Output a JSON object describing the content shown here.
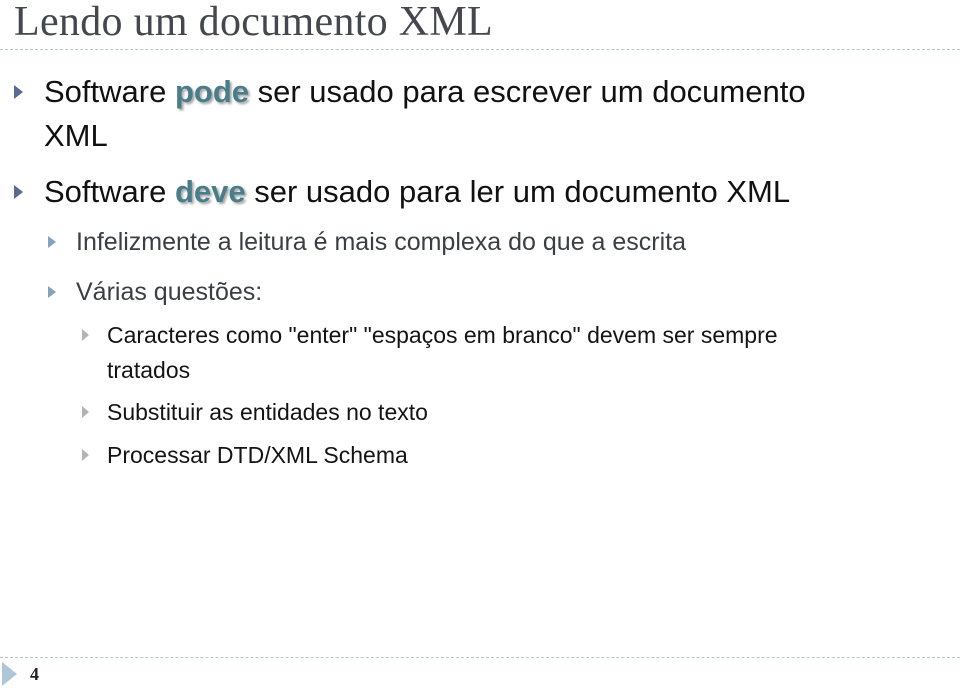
{
  "slide": {
    "title": "Lendo um documento XML",
    "page_number": "4",
    "accent_color": "#4a7d8a"
  },
  "bullets": {
    "b1": {
      "prefix": "Software ",
      "emphasis": "pode",
      "suffix": " ser usado para escrever um documento",
      "continuation": "XML"
    },
    "b2": {
      "prefix": "Software ",
      "emphasis": "deve",
      "suffix": " ser usado para ler um documento XML"
    },
    "b2_1": "Infelizmente a leitura é mais complexa do que a escrita",
    "b2_2": "Várias questões:",
    "b2_2_1": {
      "line1": "Caracteres como \"enter\" \"espaços em branco\" devem ser sempre",
      "line2": "tratados"
    },
    "b2_2_2": "Substituir as entidades no texto",
    "b2_2_3": "Processar DTD/XML Schema"
  }
}
